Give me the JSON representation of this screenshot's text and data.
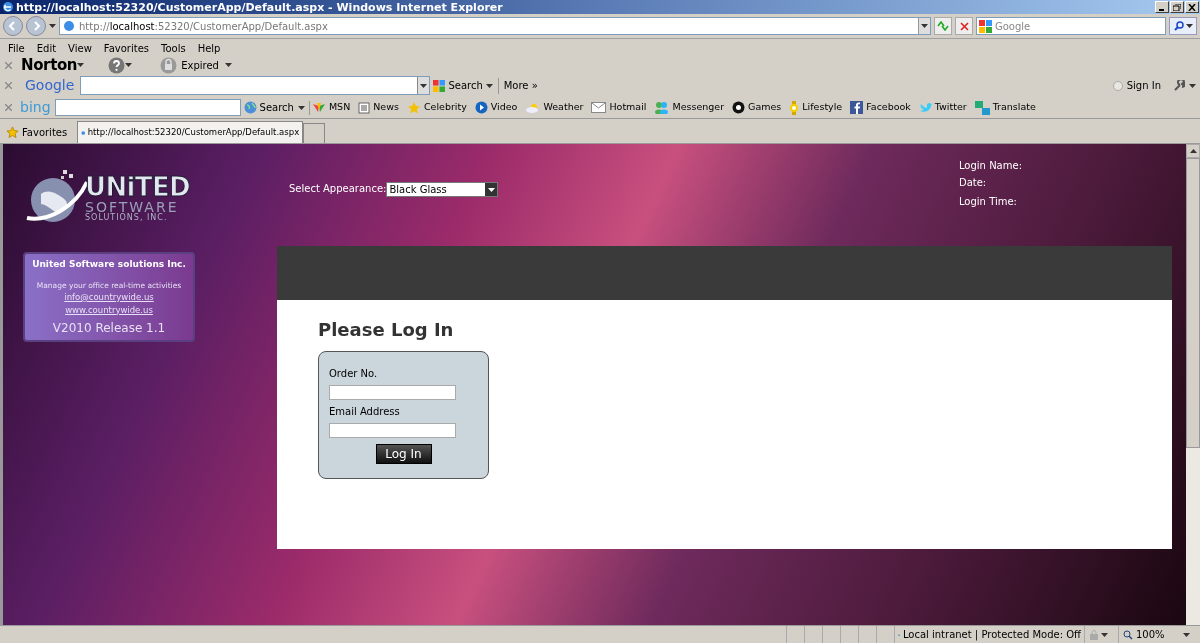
{
  "window": {
    "title": "http://localhost:52320/CustomerApp/Default.aspx - Windows Internet Explorer"
  },
  "address_bar": {
    "url_prefix": "http://",
    "url_host": "localhost",
    "url_rest": ":52320/CustomerApp/Default.aspx"
  },
  "search_box": {
    "placeholder": "Google"
  },
  "menu": [
    "File",
    "Edit",
    "View",
    "Favorites",
    "Tools",
    "Help"
  ],
  "norton": {
    "brand": "Norton",
    "status": "Expired"
  },
  "google_toolbar": {
    "brand": "Google",
    "search": "Search",
    "more": "More »",
    "sign_in": "Sign In"
  },
  "bing_toolbar": {
    "brand": "bing",
    "search": "Search",
    "links": [
      {
        "label": "MSN",
        "kind": "msn"
      },
      {
        "label": "News",
        "kind": "news"
      },
      {
        "label": "Celebrity",
        "kind": "star"
      },
      {
        "label": "Video",
        "kind": "video"
      },
      {
        "label": "Weather",
        "kind": "weather"
      },
      {
        "label": "Hotmail",
        "kind": "mail"
      },
      {
        "label": "Messenger",
        "kind": "people"
      },
      {
        "label": "Games",
        "kind": "ball"
      },
      {
        "label": "Lifestyle",
        "kind": "watch"
      },
      {
        "label": "Facebook",
        "kind": "facebook"
      },
      {
        "label": "Twitter",
        "kind": "bird"
      },
      {
        "label": "Translate",
        "kind": "translate"
      }
    ]
  },
  "favorites_bar": {
    "label": "Favorites",
    "tab": "http://localhost:52320/CustomerApp/Default.aspx"
  },
  "page": {
    "logo": {
      "line1": "UNiTED",
      "line2": "SOFTWARE",
      "line3": "SOLUTIONS, INC."
    },
    "appearance": {
      "label": "Select Appearance:",
      "value": "Black Glass"
    },
    "session": [
      "Login Name:",
      "Date:",
      "Login Time:"
    ],
    "info_card": {
      "title": "United Software solutions Inc.",
      "tagline": "Manage your office real-time activities",
      "email": "info@countrywide.us",
      "website": "www.countrywide.us",
      "version": "V2010 Release 1.1"
    },
    "login": {
      "heading": "Please Log In",
      "fields": [
        {
          "label": "Order No."
        },
        {
          "label": "Email Address"
        }
      ],
      "button": "Log In"
    }
  },
  "status_bar": {
    "zone": "Local intranet | Protected Mode: Off",
    "zoom": "100%"
  }
}
